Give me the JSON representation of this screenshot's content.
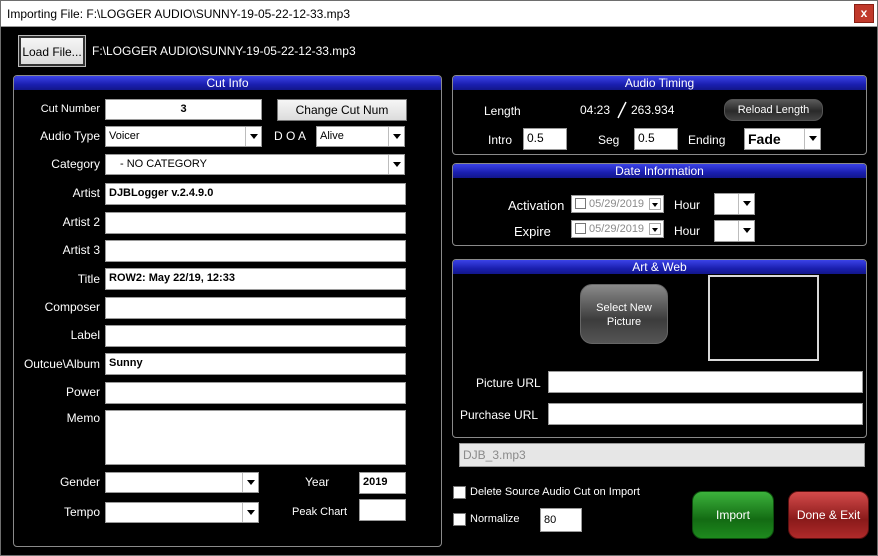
{
  "window": {
    "title": "Importing File: F:\\LOGGER AUDIO\\SUNNY-19-05-22-12-33.mp3",
    "close_label": "x"
  },
  "toolbar": {
    "load_label": "Load File...",
    "file_path": "F:\\LOGGER AUDIO\\SUNNY-19-05-22-12-33.mp3"
  },
  "cut_info": {
    "header": "Cut Info",
    "cut_number_label": "Cut Number",
    "cut_number": "3",
    "change_cut_label": "Change Cut Num",
    "audio_type_label": "Audio Type",
    "audio_type": "Voicer",
    "doa_label": "D O A",
    "doa": "Alive",
    "category_label": "Category",
    "category": "- NO CATEGORY",
    "artist_label": "Artist",
    "artist": "DJBLogger v.2.4.9.0",
    "artist2_label": "Artist 2",
    "artist2": "",
    "artist3_label": "Artist 3",
    "artist3": "",
    "title_label": "Title",
    "title": "ROW2: May 22/19, 12:33",
    "composer_label": "Composer",
    "composer": "",
    "label_label": "Label",
    "label": "",
    "album_label": "Outcue\\Album",
    "album": "Sunny",
    "power_label": "Power",
    "power": "",
    "memo_label": "Memo",
    "memo": "",
    "gender_label": "Gender",
    "gender": "",
    "year_label": "Year",
    "year": "2019",
    "tempo_label": "Tempo",
    "tempo": "",
    "peak_label": "Peak Chart",
    "peak": ""
  },
  "audio_timing": {
    "header": "Audio Timing",
    "length_label": "Length",
    "length_time": "04:23",
    "length_seconds": "263.934",
    "reload_label": "Reload Length",
    "intro_label": "Intro",
    "intro": "0.5",
    "seg_label": "Seg",
    "seg": "0.5",
    "ending_label": "Ending",
    "ending": "Fade"
  },
  "date_info": {
    "header": "Date Information",
    "activation_label": "Activation",
    "activation_date": "05/29/2019",
    "activation_hour_label": "Hour",
    "activation_hour": "",
    "expire_label": "Expire",
    "expire_date": "05/29/2019",
    "expire_hour_label": "Hour",
    "expire_hour": ""
  },
  "art_web": {
    "header": "Art & Web",
    "select_picture_label_1": "Select New",
    "select_picture_label_2": "Picture",
    "picture_url_label": "Picture URL",
    "picture_url": "",
    "purchase_url_label": "Purchase URL",
    "purchase_url": ""
  },
  "output_filename": "DJB_3.mp3",
  "options": {
    "delete_source_label": "Delete Source Audio Cut on Import",
    "normalize_label": "Normalize",
    "normalize_value": "80"
  },
  "actions": {
    "import_label": "Import",
    "done_label": "Done & Exit"
  },
  "colors": {
    "panel_header": "#2227c8",
    "import_button": "#1e8a1e",
    "done_button": "#b02a2a"
  }
}
